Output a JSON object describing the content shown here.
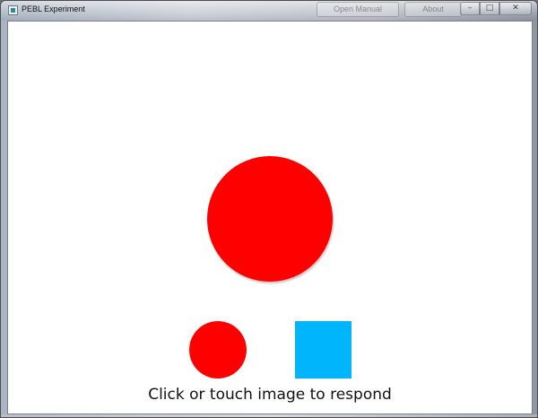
{
  "window": {
    "title": "PEBL Experiment",
    "app_icon": "pebl-app-icon",
    "background_tabs": [
      "Open Manual",
      "About"
    ],
    "controls": {
      "minimize": "–",
      "maximize": "□",
      "close": "✕"
    }
  },
  "experiment": {
    "target_shape": {
      "shape": "circle",
      "color": "#fe0000"
    },
    "choices": [
      {
        "shape": "circle",
        "color": "#fe0000"
      },
      {
        "shape": "square",
        "color": "#00b5fc"
      }
    ],
    "instruction": "Click or touch image to respond"
  }
}
